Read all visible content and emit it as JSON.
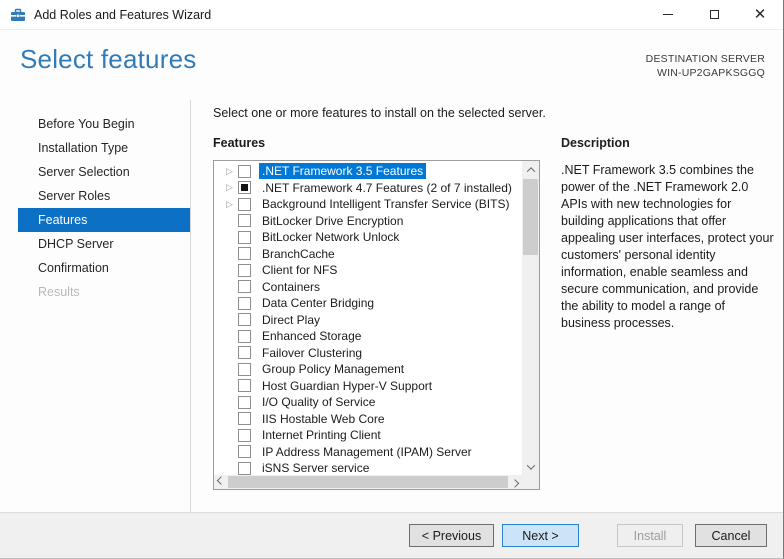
{
  "window": {
    "title": "Add Roles and Features Wizard",
    "controls": {
      "minimize": "minimize",
      "maximize": "maximize",
      "close": "close"
    }
  },
  "header": {
    "title": "Select features",
    "destination_label": "DESTINATION SERVER",
    "destination_server": "WIN-UP2GAPKSGGQ"
  },
  "sidebar": {
    "items": [
      {
        "label": "Before You Begin",
        "state": "normal"
      },
      {
        "label": "Installation Type",
        "state": "normal"
      },
      {
        "label": "Server Selection",
        "state": "normal"
      },
      {
        "label": "Server Roles",
        "state": "normal"
      },
      {
        "label": "Features",
        "state": "selected"
      },
      {
        "label": "DHCP Server",
        "state": "normal"
      },
      {
        "label": "Confirmation",
        "state": "normal"
      },
      {
        "label": "Results",
        "state": "disabled"
      }
    ]
  },
  "main": {
    "instruction": "Select one or more features to install on the selected server.",
    "features_label": "Features",
    "features": [
      {
        "label": ".NET Framework 3.5 Features",
        "checked": "unchecked",
        "expandable": true,
        "selected": true
      },
      {
        "label": ".NET Framework 4.7 Features (2 of 7 installed)",
        "checked": "partial",
        "expandable": true,
        "selected": false
      },
      {
        "label": "Background Intelligent Transfer Service (BITS)",
        "checked": "unchecked",
        "expandable": true,
        "selected": false
      },
      {
        "label": "BitLocker Drive Encryption",
        "checked": "unchecked",
        "expandable": false,
        "selected": false
      },
      {
        "label": "BitLocker Network Unlock",
        "checked": "unchecked",
        "expandable": false,
        "selected": false
      },
      {
        "label": "BranchCache",
        "checked": "unchecked",
        "expandable": false,
        "selected": false
      },
      {
        "label": "Client for NFS",
        "checked": "unchecked",
        "expandable": false,
        "selected": false
      },
      {
        "label": "Containers",
        "checked": "unchecked",
        "expandable": false,
        "selected": false
      },
      {
        "label": "Data Center Bridging",
        "checked": "unchecked",
        "expandable": false,
        "selected": false
      },
      {
        "label": "Direct Play",
        "checked": "unchecked",
        "expandable": false,
        "selected": false
      },
      {
        "label": "Enhanced Storage",
        "checked": "unchecked",
        "expandable": false,
        "selected": false
      },
      {
        "label": "Failover Clustering",
        "checked": "unchecked",
        "expandable": false,
        "selected": false
      },
      {
        "label": "Group Policy Management",
        "checked": "unchecked",
        "expandable": false,
        "selected": false
      },
      {
        "label": "Host Guardian Hyper-V Support",
        "checked": "unchecked",
        "expandable": false,
        "selected": false
      },
      {
        "label": "I/O Quality of Service",
        "checked": "unchecked",
        "expandable": false,
        "selected": false
      },
      {
        "label": "IIS Hostable Web Core",
        "checked": "unchecked",
        "expandable": false,
        "selected": false
      },
      {
        "label": "Internet Printing Client",
        "checked": "unchecked",
        "expandable": false,
        "selected": false
      },
      {
        "label": "IP Address Management (IPAM) Server",
        "checked": "unchecked",
        "expandable": false,
        "selected": false
      },
      {
        "label": "iSNS Server service",
        "checked": "unchecked",
        "expandable": false,
        "selected": false
      }
    ]
  },
  "description_panel": {
    "title": "Description",
    "text": ".NET Framework 3.5 combines the power of the .NET Framework 2.0 APIs with new technologies for building applications that offer appealing user interfaces, protect your customers' personal identity information, enable seamless and secure communication, and provide the ability to model a range of business processes."
  },
  "footer": {
    "previous_label": "< Previous",
    "next_label": "Next >",
    "install_label": "Install",
    "cancel_label": "Cancel"
  },
  "colors": {
    "sidebar_selected": "#0c71c4",
    "list_selection": "#0078d7",
    "title_text": "#2f7cb8",
    "next_button_fill": "#cce4f7",
    "next_button_border": "#2a80c9",
    "footer_bg": "#f0f0f0",
    "scroll_thumb": "#cdcdcd"
  }
}
